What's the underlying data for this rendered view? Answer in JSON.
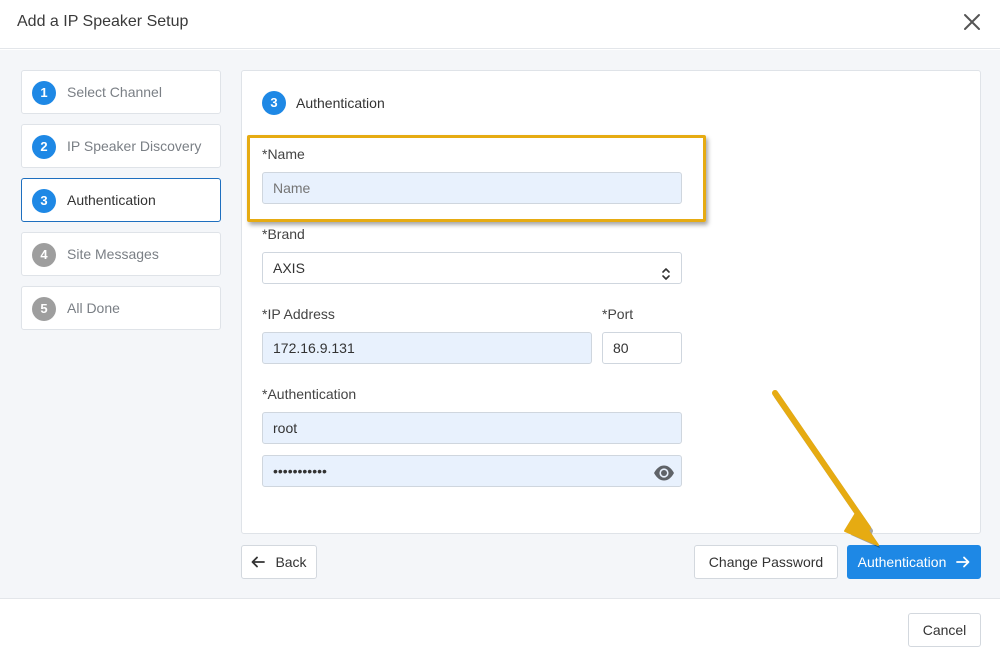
{
  "dialog": {
    "title": "Add a IP Speaker Setup"
  },
  "steps": [
    {
      "num": "1",
      "label": "Select Channel",
      "state": "done"
    },
    {
      "num": "2",
      "label": "IP Speaker Discovery",
      "state": "done"
    },
    {
      "num": "3",
      "label": "Authentication",
      "state": "active"
    },
    {
      "num": "4",
      "label": "Site Messages",
      "state": "pending"
    },
    {
      "num": "5",
      "label": "All Done",
      "state": "pending"
    }
  ],
  "panel": {
    "step_num": "3",
    "step_label": "Authentication",
    "name_label": "*Name",
    "name_placeholder": "Name",
    "brand_label": "*Brand",
    "brand_value": "AXIS",
    "ip_label": "*IP Address",
    "ip_value": "172.16.9.131",
    "port_label": "*Port",
    "port_value": "80",
    "auth_label": "*Authentication",
    "username_value": "root",
    "password_value": "•••••••••••"
  },
  "buttons": {
    "back": "Back",
    "change_password": "Change Password",
    "next": "Authentication",
    "cancel": "Cancel"
  },
  "colors": {
    "primary": "#1e88e5",
    "highlight": "#e6ab12"
  }
}
